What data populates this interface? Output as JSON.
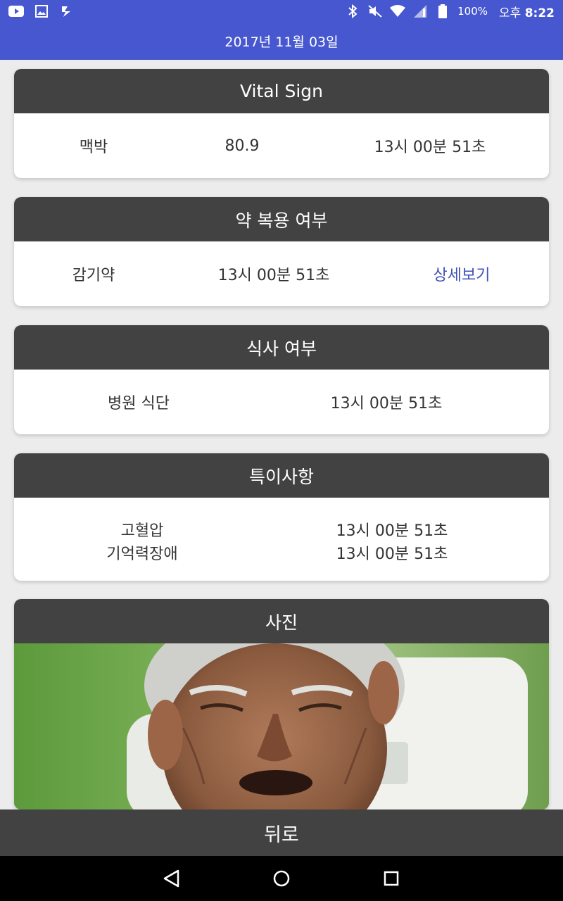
{
  "status_bar": {
    "battery_text": "100%",
    "time_prefix": "오후",
    "time": "8:22"
  },
  "app_bar": {
    "title": "2017년 11월 03일"
  },
  "vital_sign": {
    "title": "Vital Sign",
    "label": "맥박",
    "value": "80.9",
    "time": "13시 00분 51초"
  },
  "medication": {
    "title": "약 복용 여부",
    "label": "감기약",
    "time": "13시 00분 51초",
    "detail_link": "상세보기",
    "link_color": "#3f51b5"
  },
  "meal": {
    "title": "식사 여부",
    "label": "병원 식단",
    "time": "13시 00분 51초"
  },
  "notes": {
    "title": "특이사항",
    "items": [
      {
        "label": "고혈압",
        "time": "13시 00분 51초"
      },
      {
        "label": "기억력장애",
        "time": "13시 00분 51초"
      }
    ]
  },
  "photo": {
    "title": "사진"
  },
  "back_button": {
    "label": "뒤로"
  },
  "colors": {
    "primary": "#4657cf",
    "card_header": "#424242"
  }
}
